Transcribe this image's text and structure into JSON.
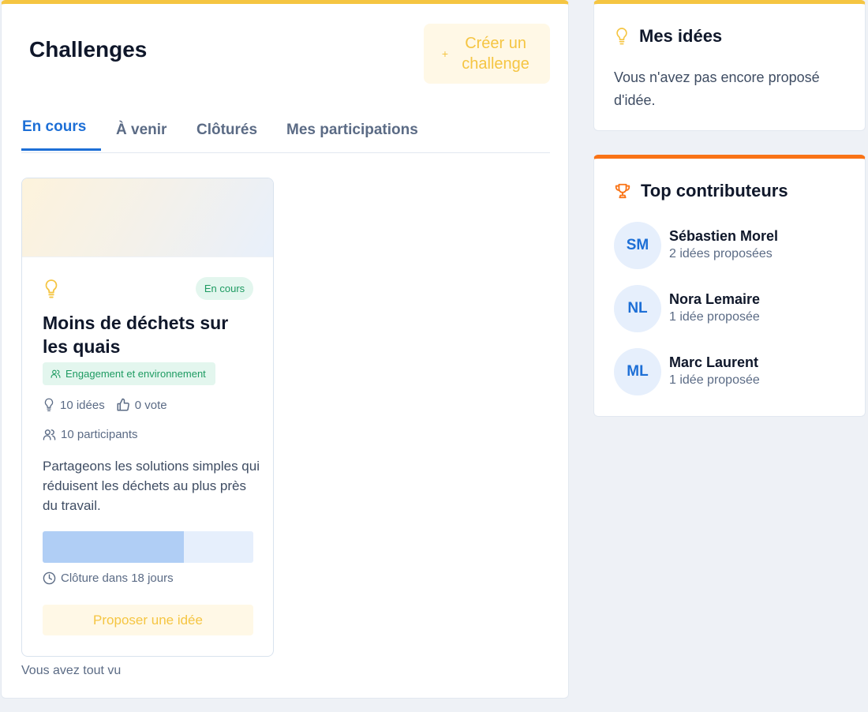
{
  "header": {
    "title": "Challenges",
    "create_button": {
      "icon": "plus-icon",
      "label": "Créer un challenge"
    }
  },
  "tabs": [
    {
      "label": "En cours",
      "active": true
    },
    {
      "label": "À venir",
      "active": false
    },
    {
      "label": "Clôturés",
      "active": false
    },
    {
      "label": "Mes participations",
      "active": false
    }
  ],
  "challenge": {
    "status": "En cours",
    "title": "Moins de déchets sur les quais",
    "category": "Engagement et environnement",
    "ideas": "10 idées",
    "votes": "0 vote",
    "participants": "10 participants",
    "description": "Partageons les solutions simples qui réduisent les déchets au plus près du travail.",
    "progress_fraction": 0.67,
    "deadline": "Clôture dans 18 jours",
    "cta": "Proposer une idée"
  },
  "end_message": "Vous avez tout vu",
  "my_ideas": {
    "title": "Mes idées",
    "empty_text": "Vous n'avez pas encore proposé d'idée."
  },
  "top_contributors": {
    "title": "Top contributeurs",
    "items": [
      {
        "initials": "SM",
        "name": "Sébastien Morel",
        "count": "2 idées proposées"
      },
      {
        "initials": "NL",
        "name": "Nora Lemaire",
        "count": "1 idée proposée"
      },
      {
        "initials": "ML",
        "name": "Marc Laurent",
        "count": "1 idée proposée"
      }
    ]
  },
  "colors": {
    "accent_yellow": "#f5c542",
    "accent_blue": "#1d6fd6",
    "accent_orange": "#f97316",
    "badge_green": "#1e9b62"
  }
}
